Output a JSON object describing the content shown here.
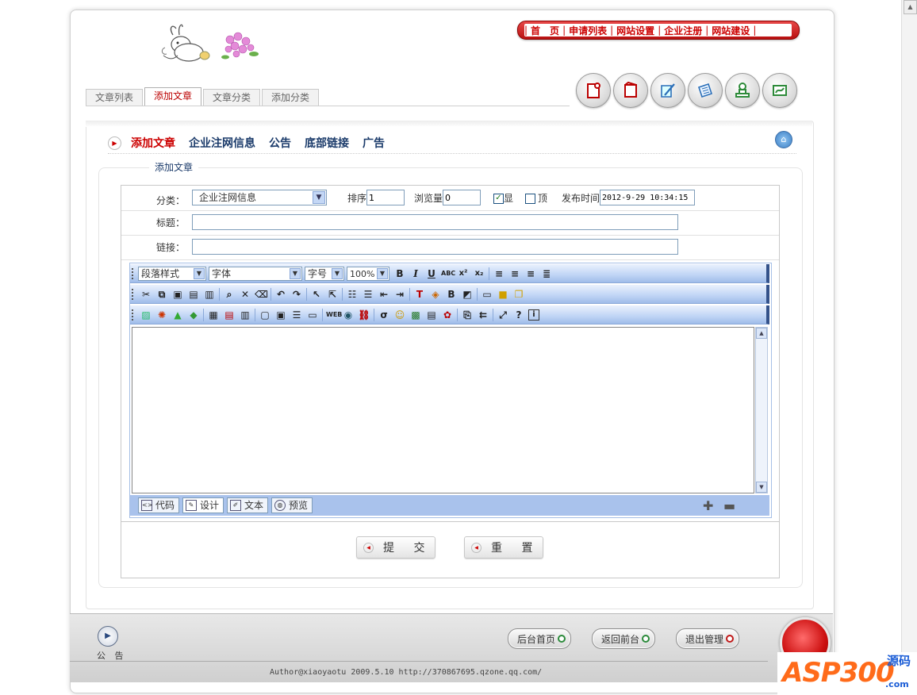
{
  "top_nav": [
    "首　页",
    "申请列表",
    "网站设置",
    "企业注册",
    "网站建设"
  ],
  "tabs": [
    "文章列表",
    "添加文章",
    "文章分类",
    "添加分类"
  ],
  "content_nav": [
    "添加文章",
    "企业注网信息",
    "公告",
    "底部链接",
    "广告"
  ],
  "legend": "添加文章",
  "form": {
    "category_label": "分类：",
    "category_value": "企业注网信息",
    "sort_label": "排序",
    "sort_value": "1",
    "views_label": "浏览量",
    "views_value": "0",
    "show_label": "显",
    "show_checked": true,
    "top_label": "顶",
    "top_checked": false,
    "publish_label": "发布时间",
    "publish_value": "2012-9-29 10:34:15",
    "title_label": "标题：",
    "title_value": "",
    "link_label": "链接：",
    "link_value": ""
  },
  "editor": {
    "paragraph_style": "段落样式",
    "font": "字体",
    "font_size": "字号",
    "zoom": "100%",
    "modes": [
      "代码",
      "设计",
      "文本",
      "预览"
    ],
    "active_mode": "设计"
  },
  "buttons": {
    "submit": "提 交",
    "reset": "重 置"
  },
  "footer": {
    "gonggao": "公 告",
    "admin_home": "后台首页",
    "front_home": "返回前台",
    "logout": "退出管理",
    "author": "Author@xiaoyaotu 2009.5.10 http://370867695.qzone.qq.com/"
  },
  "watermark": {
    "brand": "ASP300",
    "code": "源码",
    "domain": ".com"
  },
  "colors": {
    "accent_red": "#c00000",
    "nav_blue": "#1a3a6a",
    "editor_blue": "#a9c2ec"
  }
}
